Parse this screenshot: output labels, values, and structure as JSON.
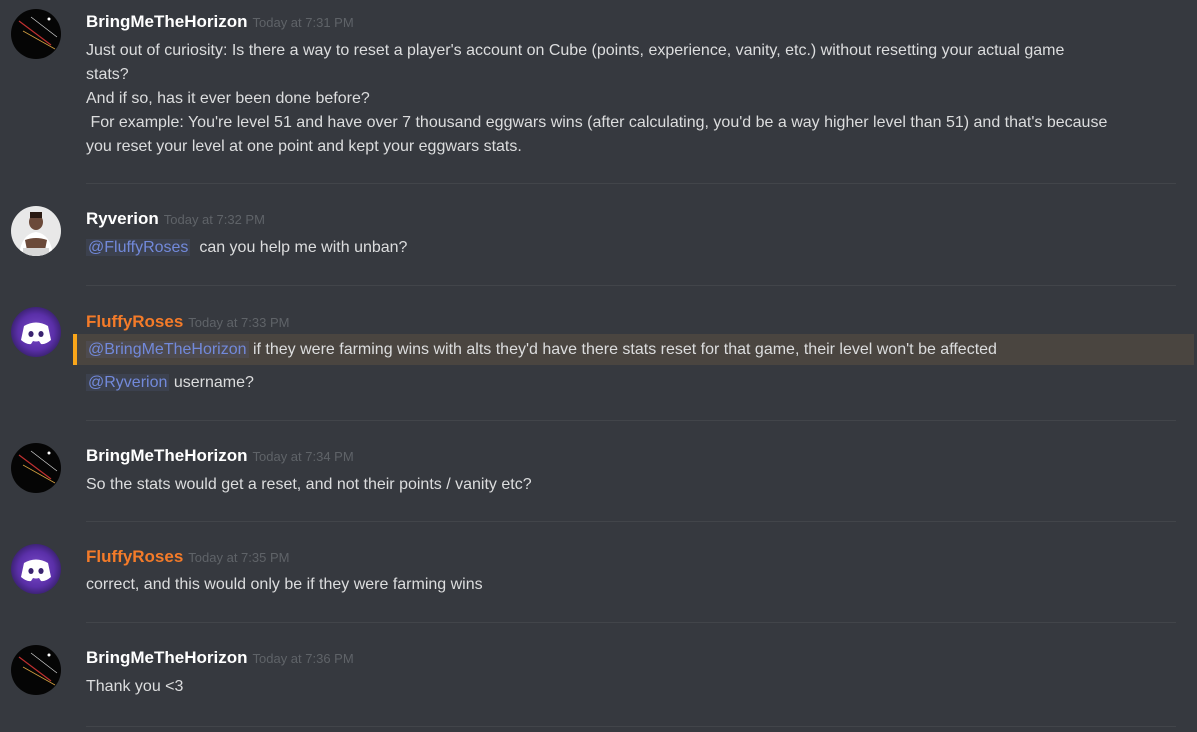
{
  "colors": {
    "background": "#36393f",
    "text": "#dcddde",
    "author": "#ffffff",
    "author_orange": "#f47b29",
    "timestamp": "#5f6368",
    "mention": "#7289da",
    "highlight_border": "#faa61a"
  },
  "messages": [
    {
      "author": "BringMeTheHorizon",
      "timestamp": "Today at 7:31 PM",
      "avatar": "dark-streak-avatar",
      "lines": [
        "Just out of curiosity: Is there a way to reset a player's account on Cube (points, experience, vanity, etc.) without resetting your actual game",
        "stats?",
        "And if so, has it ever been done before?",
        " For example: You're level 51 and have over 7 thousand eggwars wins (after calculating, you'd be a way higher level than 51) and that's because",
        "you reset your level at one point and kept your eggwars stats."
      ]
    },
    {
      "author": "Ryverion",
      "timestamp": "Today at 7:32 PM",
      "avatar": "photo-avatar",
      "mention": "@FluffyRoses",
      "text": "can you help me with unban?"
    },
    {
      "author": "FluffyRoses",
      "timestamp": "Today at 7:33 PM",
      "avatar": "discord-logo-avatar",
      "line1_mention": "@BringMeTheHorizon",
      "line1_text": "if they were farming wins with alts they'd have there stats reset for that game, their level won't be affected",
      "line2_mention": "@Ryverion",
      "line2_text": "username?"
    },
    {
      "author": "BringMeTheHorizon",
      "timestamp": "Today at 7:34 PM",
      "avatar": "dark-streak-avatar",
      "text": "So the stats would get a reset, and not their points / vanity etc?"
    },
    {
      "author": "FluffyRoses",
      "timestamp": "Today at 7:35 PM",
      "avatar": "discord-logo-avatar",
      "text": "correct, and this would only be if they were farming wins"
    },
    {
      "author": "BringMeTheHorizon",
      "timestamp": "Today at 7:36 PM",
      "avatar": "dark-streak-avatar",
      "text": "Thank you <3"
    }
  ]
}
